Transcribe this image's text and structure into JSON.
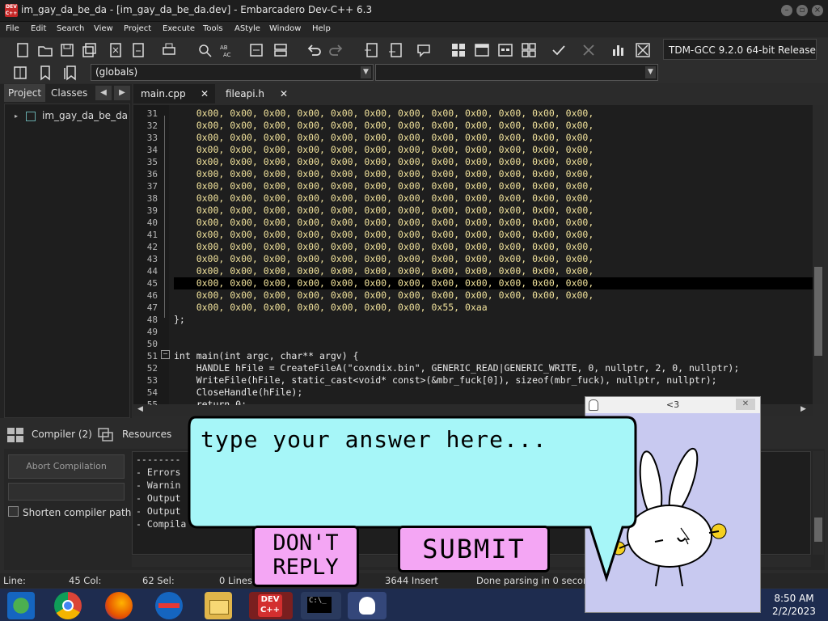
{
  "window": {
    "title": "im_gay_da_be_da - [im_gay_da_be_da.dev] - Embarcadero Dev-C++ 6.3",
    "app_logo": "DEV C++"
  },
  "menu": [
    "File",
    "Edit",
    "Search",
    "View",
    "Project",
    "Execute",
    "Tools",
    "AStyle",
    "Window",
    "Help"
  ],
  "toolbar": {
    "compiler": "TDM-GCC 9.2.0 64-bit Release",
    "scope": "(globals)"
  },
  "left_panel": {
    "tabs": [
      "Project",
      "Classes"
    ],
    "tree_root": "im_gay_da_be_da"
  },
  "editor": {
    "tabs": [
      "main.cpp",
      "fileapi.h"
    ],
    "hex_row": "0x00, 0x00, 0x00, 0x00, 0x00, 0x00, 0x00, 0x00, 0x00, 0x00, 0x00, 0x00,",
    "lines": [
      {
        "n": "31",
        "text": "    0x00, 0x00, 0x00, 0x00, 0x00, 0x00, 0x00, 0x00, 0x00, 0x00, 0x00, 0x00,"
      },
      {
        "n": "32",
        "text": "    0x00, 0x00, 0x00, 0x00, 0x00, 0x00, 0x00, 0x00, 0x00, 0x00, 0x00, 0x00,"
      },
      {
        "n": "33",
        "text": "    0x00, 0x00, 0x00, 0x00, 0x00, 0x00, 0x00, 0x00, 0x00, 0x00, 0x00, 0x00,"
      },
      {
        "n": "34",
        "text": "    0x00, 0x00, 0x00, 0x00, 0x00, 0x00, 0x00, 0x00, 0x00, 0x00, 0x00, 0x00,"
      },
      {
        "n": "35",
        "text": "    0x00, 0x00, 0x00, 0x00, 0x00, 0x00, 0x00, 0x00, 0x00, 0x00, 0x00, 0x00,"
      },
      {
        "n": "36",
        "text": "    0x00, 0x00, 0x00, 0x00, 0x00, 0x00, 0x00, 0x00, 0x00, 0x00, 0x00, 0x00,"
      },
      {
        "n": "37",
        "text": "    0x00, 0x00, 0x00, 0x00, 0x00, 0x00, 0x00, 0x00, 0x00, 0x00, 0x00, 0x00,"
      },
      {
        "n": "38",
        "text": "    0x00, 0x00, 0x00, 0x00, 0x00, 0x00, 0x00, 0x00, 0x00, 0x00, 0x00, 0x00,"
      },
      {
        "n": "39",
        "text": "    0x00, 0x00, 0x00, 0x00, 0x00, 0x00, 0x00, 0x00, 0x00, 0x00, 0x00, 0x00,"
      },
      {
        "n": "40",
        "text": "    0x00, 0x00, 0x00, 0x00, 0x00, 0x00, 0x00, 0x00, 0x00, 0x00, 0x00, 0x00,"
      },
      {
        "n": "41",
        "text": "    0x00, 0x00, 0x00, 0x00, 0x00, 0x00, 0x00, 0x00, 0x00, 0x00, 0x00, 0x00,"
      },
      {
        "n": "42",
        "text": "    0x00, 0x00, 0x00, 0x00, 0x00, 0x00, 0x00, 0x00, 0x00, 0x00, 0x00, 0x00,"
      },
      {
        "n": "43",
        "text": "    0x00, 0x00, 0x00, 0x00, 0x00, 0x00, 0x00, 0x00, 0x00, 0x00, 0x00, 0x00,"
      },
      {
        "n": "44",
        "text": "    0x00, 0x00, 0x00, 0x00, 0x00, 0x00, 0x00, 0x00, 0x00, 0x00, 0x00, 0x00,"
      },
      {
        "n": "45",
        "text": "    0x00, 0x00, 0x00, 0x00, 0x00, 0x00, 0x00, 0x00, 0x00, 0x00, 0x00, 0x00,"
      },
      {
        "n": "46",
        "text": "    0x00, 0x00, 0x00, 0x00, 0x00, 0x00, 0x00, 0x00, 0x00, 0x00, 0x00, 0x00,"
      },
      {
        "n": "47",
        "text": "    0x00, 0x00, 0x00, 0x00, 0x00, 0x00, 0x00, 0x55, 0xaa"
      },
      {
        "n": "48",
        "text": "};"
      },
      {
        "n": "49",
        "text": ""
      },
      {
        "n": "50",
        "text": ""
      },
      {
        "n": "51",
        "text": "int main(int argc, char** argv) {"
      },
      {
        "n": "52",
        "text": "    HANDLE hFile = CreateFileA(\"coxndix.bin\", GENERIC_READ|GENERIC_WRITE, 0, nullptr, 2, 0, nullptr);"
      },
      {
        "n": "53",
        "text": "    WriteFile(hFile, static_cast<void* const>(&mbr_fuck[0]), sizeof(mbr_fuck), nullptr, nullptr);"
      },
      {
        "n": "54",
        "text": "    CloseHandle(hFile);"
      },
      {
        "n": "55",
        "text": "    return 0;"
      }
    ]
  },
  "bottom_panel": {
    "tabs": [
      "Compiler (2)",
      "Resources"
    ],
    "abort_label": "Abort Compilation",
    "shorten_label": "Shorten compiler path",
    "output": [
      "--------",
      "- Errors",
      "- Warnin",
      "- Output",
      "- Output",
      "- Compila"
    ]
  },
  "status": {
    "line": "Line:",
    "line_val": "45 Col:",
    "col_val": "62 Sel:",
    "sel_val": "0 Lines:",
    "insert": "3644 Insert",
    "parse": "Done parsing in 0 secon"
  },
  "taskbar": {
    "time": "8:50 AM",
    "date": "2/2/2023",
    "devcpp_label": "DEV C++"
  },
  "popup": {
    "title": "<3",
    "placeholder": "type your answer here...",
    "dont_reply": "DON'T REPLY",
    "dont_reply_l1": "DON'T",
    "dont_reply_l2": "REPLY",
    "submit": "SUBMIT"
  }
}
